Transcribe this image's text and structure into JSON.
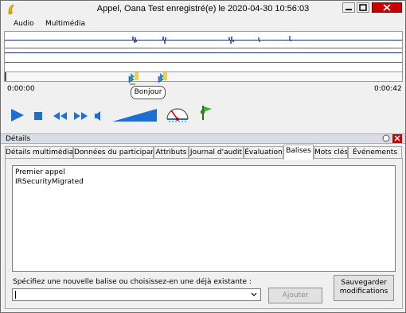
{
  "window": {
    "title": "Appel, Oana Test enregistré(e) le 2020-04-30 10:56:03",
    "icons": [
      "app-icon",
      "minimize-icon",
      "maximize-icon",
      "close-icon"
    ]
  },
  "menu": {
    "items": [
      "Audio",
      "Multimédia"
    ]
  },
  "player": {
    "time_start": "0:00:00",
    "time_end": "0:00:42",
    "marker_tooltip": "Bonjour",
    "controls": [
      "play-icon",
      "stop-icon",
      "rewind-icon",
      "fast-forward-icon",
      "volume-icon",
      "volume-slider",
      "speed-gauge-icon",
      "flag-icon"
    ]
  },
  "details": {
    "label": "Détails",
    "tabs": [
      "Détails multimédia",
      "Données du participant",
      "Attributs",
      "Journal d'audit",
      "Évaluation",
      "Balises",
      "Mots clés",
      "Événements"
    ],
    "active_tab": "Balises"
  },
  "tags": {
    "items": [
      "Premier appel",
      "IRSecurityMigrated"
    ],
    "prompt": "Spécifiez une nouvelle balise ou choisissez-en une déjà existante :",
    "input_value": "",
    "add_button": "Ajouter",
    "save_button": "Sauvegarder modifications"
  },
  "colors": {
    "accent_blue": "#1f6fd1",
    "title_close": "#c80000",
    "waveform": "#1f2f7a"
  }
}
